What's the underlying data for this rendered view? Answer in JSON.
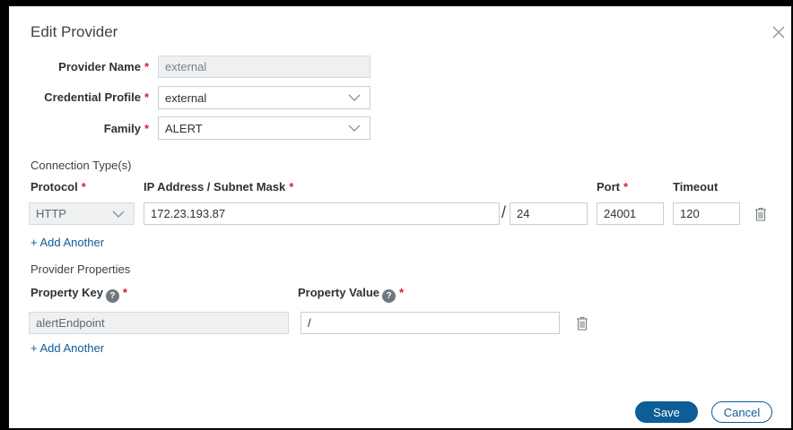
{
  "dialog": {
    "title": "Edit Provider",
    "close_icon": "close-icon"
  },
  "form": {
    "provider_name": {
      "label": "Provider Name",
      "required_mark": "*",
      "value": "external",
      "disabled": true
    },
    "credential_profile": {
      "label": "Credential Profile",
      "required_mark": "*",
      "value": "external"
    },
    "family": {
      "label": "Family",
      "required_mark": "*",
      "value": "ALERT"
    }
  },
  "connection": {
    "section_title": "Connection Type(s)",
    "headers": {
      "protocol": "Protocol",
      "ip": "IP Address / Subnet Mask",
      "port": "Port",
      "timeout": "Timeout",
      "required_mark": "*"
    },
    "row": {
      "protocol": "HTTP",
      "ip": "172.23.193.87",
      "separator": "/",
      "mask": "24",
      "port": "24001",
      "timeout": "120"
    },
    "add_another": "+ Add Another"
  },
  "properties": {
    "section_title": "Provider Properties",
    "headers": {
      "key": "Property Key",
      "value": "Property Value",
      "help_glyph": "?",
      "required_mark": "*"
    },
    "row": {
      "key": "alertEndpoint",
      "value": "/"
    },
    "add_another": "+ Add Another"
  },
  "footer": {
    "save": "Save",
    "cancel": "Cancel"
  },
  "colors": {
    "primary": "#0d5d96",
    "required": "#d81e2a"
  }
}
